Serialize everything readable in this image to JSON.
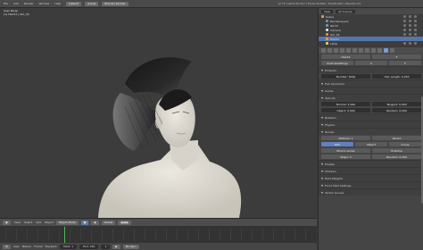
{
  "topbar": {
    "menus": [
      "File",
      "Add",
      "Render",
      "Window",
      "Help"
    ],
    "layout": "Default",
    "scene": "Scene",
    "engine": "Blender Render",
    "stats": "v2.79 | Verts:45,312 | Faces:44,800 | Tris:89,600 | Objects:1/3"
  },
  "viewport": {
    "info_line1": "User Persp",
    "info_line2": "(1) Hair01 | Girl_03"
  },
  "viewport_header": {
    "view": "View",
    "select": "Select",
    "add": "Add",
    "object": "Object",
    "mode": "Object Mode",
    "pivot": "Global"
  },
  "timeline": {
    "view": "View",
    "marker": "Marker",
    "frame": "Frame",
    "playback": "Playback",
    "start": "Start: 1",
    "end": "End: 250",
    "current": "1",
    "sync": "No Sync"
  },
  "outliner": {
    "view": "View",
    "search": "All Scenes",
    "rows": [
      {
        "label": "Scene",
        "color": "#c9a455"
      },
      {
        "label": "RenderLayers",
        "color": "#8a8a8a"
      },
      {
        "label": "World",
        "color": "#5a9bd5"
      },
      {
        "label": "Camera",
        "color": "#e5e5e5"
      },
      {
        "label": "Girl_03",
        "color": "#e39a3b"
      },
      {
        "label": "Hair01",
        "color": "#e39a3b"
      },
      {
        "label": "Lamp",
        "color": "#f0d060"
      }
    ]
  },
  "properties": {
    "rows": [
      {
        "type": "buttons",
        "items": [
          "Hair01",
          "F"
        ]
      },
      {
        "type": "buttons",
        "items": [
          "ParticleSettings",
          "2",
          "F"
        ]
      },
      {
        "type": "sect",
        "label": "Emission"
      },
      {
        "type": "buttons",
        "items": [
          "Number: 5000",
          "Hair Length: 0.250"
        ]
      },
      {
        "type": "sect",
        "label": "Hair Dynamics"
      },
      {
        "type": "sect",
        "label": "Cache"
      },
      {
        "type": "sect",
        "label": "Velocity"
      },
      {
        "type": "buttons",
        "items": [
          "Normal: 1.000",
          "Tangent: 0.000"
        ]
      },
      {
        "type": "buttons",
        "items": [
          "Object: 0.000",
          "Random: 0.000"
        ]
      },
      {
        "type": "sect",
        "label": "Rotation"
      },
      {
        "type": "sect",
        "label": "Physics"
      },
      {
        "type": "sect",
        "label": "Render"
      },
      {
        "type": "buttons",
        "items": [
          "Material: 1",
          "Parent"
        ]
      },
      {
        "type": "buttons",
        "items": [
          "Path",
          "Object",
          "Group"
        ]
      },
      {
        "type": "buttons",
        "items": [
          "Strand render",
          "B-Spline"
        ]
      },
      {
        "type": "buttons",
        "items": [
          "Steps: 3",
          "Random: 0.000"
        ]
      },
      {
        "type": "sect",
        "label": "Display"
      },
      {
        "type": "sect",
        "label": "Children"
      },
      {
        "type": "sect",
        "label": "Field Weights"
      },
      {
        "type": "sect",
        "label": "Force Field Settings"
      },
      {
        "type": "sect",
        "label": "Vertex Groups"
      }
    ]
  },
  "colors": {
    "accent": "#5475b0",
    "skin": "#e2ded6",
    "hair": "#1a1a1a",
    "timeline_cursor": "#4dbb4d"
  }
}
